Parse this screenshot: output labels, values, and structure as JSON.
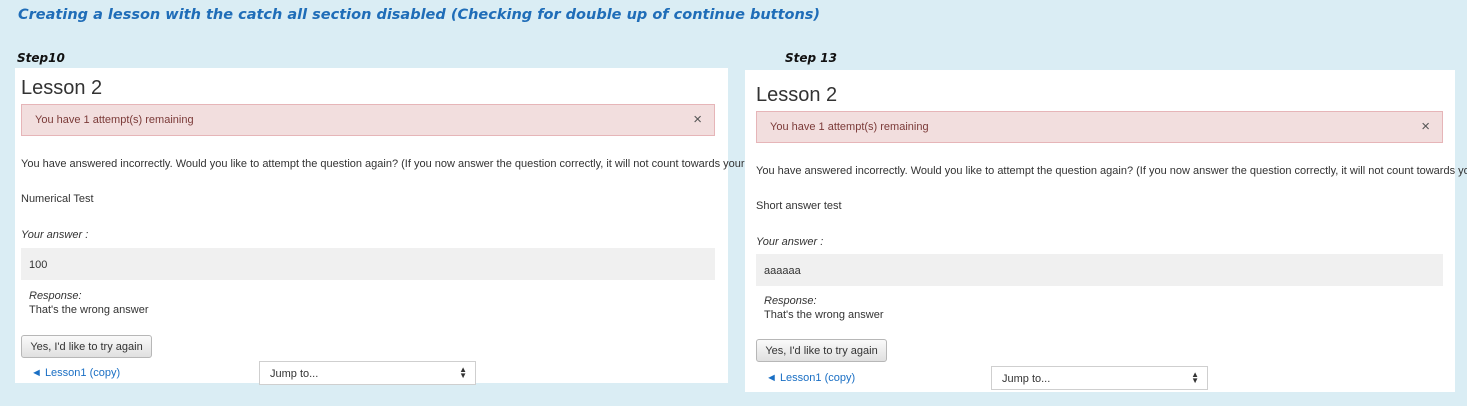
{
  "heading": "Creating a lesson with the catch all section disabled (Checking for double up of continue buttons)",
  "panels": [
    {
      "step_label": "Step10",
      "title": "Lesson 2",
      "alert": "You have 1 attempt(s) remaining",
      "alert_close": "×",
      "message": "You have answered incorrectly. Would you like to attempt the question again? (If you now answer the question correctly, it will not count towards your final score.)",
      "question": "Numerical Test",
      "your_answer_label": "Your answer :",
      "answer_value": "100",
      "response_label": "Response:",
      "response_text": "That's the wrong answer",
      "try_again_button": "Yes, I'd like to try again",
      "prev_link": "◄ Lesson1 (copy)",
      "jump_select": "Jump to..."
    },
    {
      "step_label": "Step 13",
      "title": "Lesson 2",
      "alert": "You have 1 attempt(s) remaining",
      "alert_close": "×",
      "message": "You have answered incorrectly. Would you like to attempt the question again? (If you now answer the question correctly, it will not count towards your final score.)",
      "question": "Short answer test",
      "your_answer_label": "Your answer :",
      "answer_value": "aaaaaa",
      "response_label": "Response:",
      "response_text": "That's the wrong answer",
      "try_again_button": "Yes, I'd like to try again",
      "prev_link": "◄ Lesson1 (copy)",
      "jump_select": "Jump to..."
    }
  ]
}
